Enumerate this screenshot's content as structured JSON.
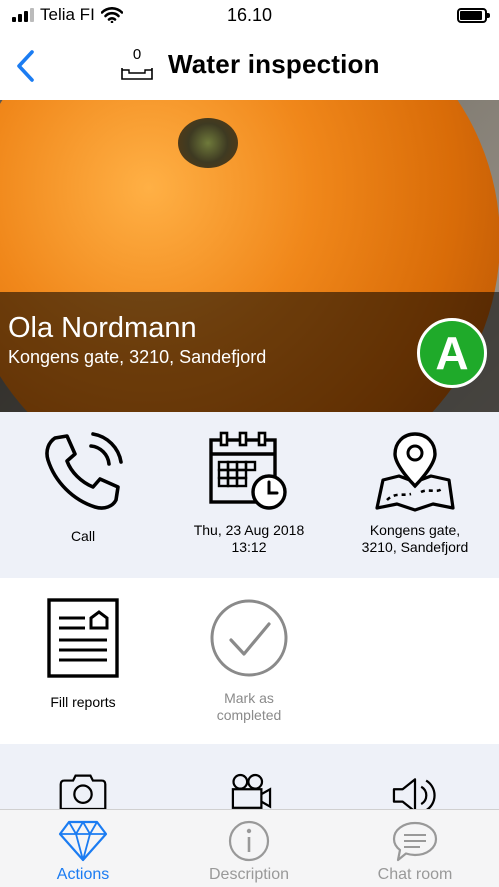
{
  "status_bar": {
    "carrier": "Telia FI",
    "time": "16.10"
  },
  "nav": {
    "back_icon": "chevron-left-icon",
    "inbox_count": "0",
    "title": "Water inspection",
    "accent_color": "#1b7cf2"
  },
  "hero": {
    "name": "Ola Nordmann",
    "address": "Kongens gate, 3210, Sandefjord",
    "grade": "A",
    "grade_color": "#1faa2a"
  },
  "actions": {
    "call": {
      "label": "Call",
      "icon": "phone-icon"
    },
    "date": {
      "label_line1": "Thu, 23 Aug 2018",
      "label_line2": "13:12",
      "icon": "calendar-clock-icon"
    },
    "location": {
      "label_line1": "Kongens gate,",
      "label_line2": "3210, Sandefjord",
      "icon": "map-pin-icon"
    },
    "fill_reports": {
      "label": "Fill reports",
      "icon": "report-document-icon"
    },
    "mark_completed": {
      "label_line1": "Mark as",
      "label_line2": "completed",
      "icon": "checkmark-circle-icon"
    },
    "camera": {
      "icon": "camera-icon"
    },
    "video": {
      "icon": "video-camera-icon"
    },
    "audio": {
      "icon": "speaker-icon"
    }
  },
  "tabs": [
    {
      "label": "Actions",
      "icon": "diamond-icon",
      "active": true
    },
    {
      "label": "Description",
      "icon": "info-icon",
      "active": false
    },
    {
      "label": "Chat room",
      "icon": "chat-bubble-icon",
      "active": false
    }
  ]
}
